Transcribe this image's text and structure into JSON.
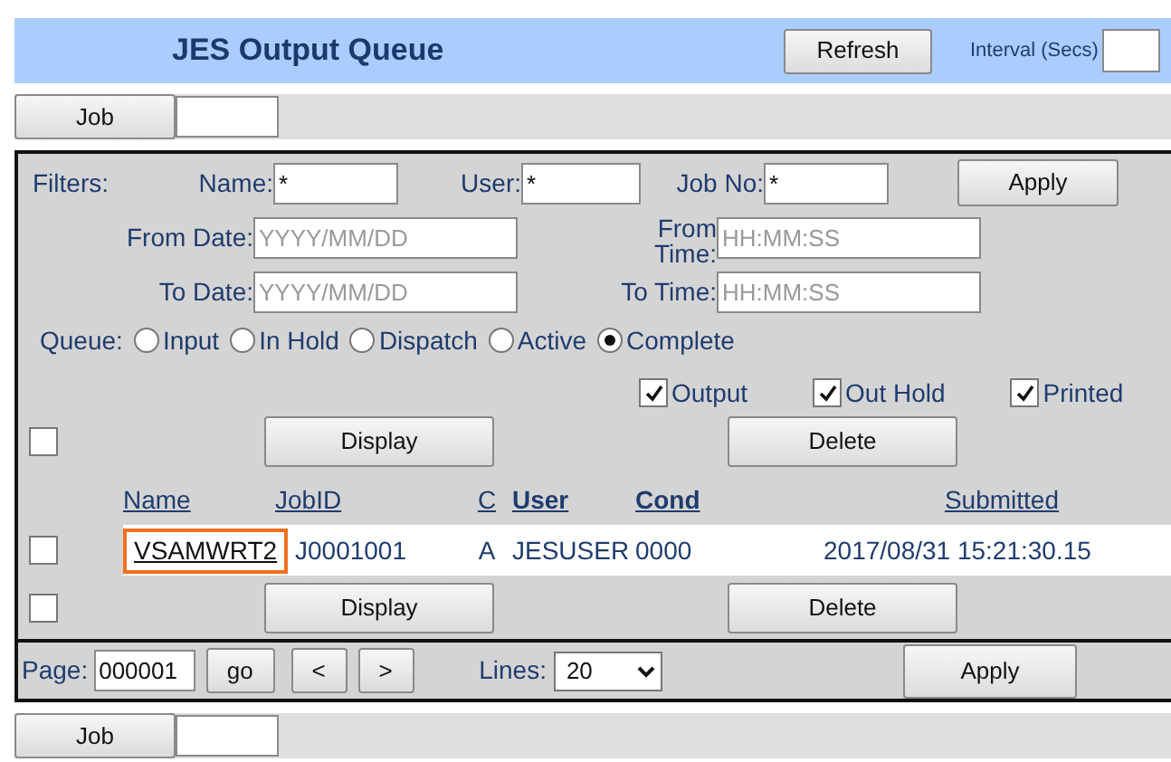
{
  "header": {
    "title": "JES Output Queue",
    "refresh_button": "Refresh",
    "interval_label": "Interval (Secs)"
  },
  "top_job_bar": {
    "button": "Job"
  },
  "filters": {
    "label": "Filters:",
    "fields": [
      {
        "label": "Name:",
        "value": "*"
      },
      {
        "label": "User:",
        "value": "*"
      },
      {
        "label": "Job No:",
        "value": "*"
      }
    ],
    "apply_button": "Apply",
    "date_rows": [
      {
        "date_label": "From Date:",
        "date_placeholder": "YYYY/MM/DD",
        "time_label": "From Time:",
        "time_placeholder": "HH:MM:SS"
      },
      {
        "date_label": "To Date:",
        "date_placeholder": "YYYY/MM/DD",
        "time_label": "To Time:",
        "time_placeholder": "HH:MM:SS"
      }
    ]
  },
  "queue": {
    "label": "Queue:",
    "options": [
      {
        "label": "Input",
        "selected": false
      },
      {
        "label": "In Hold",
        "selected": false
      },
      {
        "label": "Dispatch",
        "selected": false
      },
      {
        "label": "Active",
        "selected": false
      },
      {
        "label": "Complete",
        "selected": true
      }
    ]
  },
  "output_types": [
    {
      "label": "Output",
      "checked": true
    },
    {
      "label": "Out Hold",
      "checked": true
    },
    {
      "label": "Printed",
      "checked": true
    }
  ],
  "actions_top": {
    "checked": false,
    "buttons": [
      "Display",
      "Delete"
    ]
  },
  "table": {
    "columns": [
      {
        "label": "Name",
        "bold": false
      },
      {
        "label": "JobID",
        "bold": false
      },
      {
        "label": "C",
        "bold": false
      },
      {
        "label": "User",
        "bold": true
      },
      {
        "label": "Cond",
        "bold": true
      },
      {
        "label": "Submitted",
        "bold": false
      }
    ],
    "rows": [
      {
        "checked": false,
        "focused": true,
        "cells": [
          "VSAMWRT2",
          "J0001001",
          "A",
          "JESUSER",
          "0000",
          "2017/08/31 15:21:30.15"
        ]
      }
    ]
  },
  "actions_bottom": {
    "checked": false,
    "buttons": [
      "Display",
      "Delete"
    ]
  },
  "pager": {
    "page_label": "Page:",
    "page_value": "000001",
    "go_button": "go",
    "prev_button": "<",
    "next_button": ">",
    "lines_label": "Lines:",
    "lines_value": "20",
    "apply_button": "Apply"
  },
  "bottom_job_bar": {
    "button": "Job"
  }
}
